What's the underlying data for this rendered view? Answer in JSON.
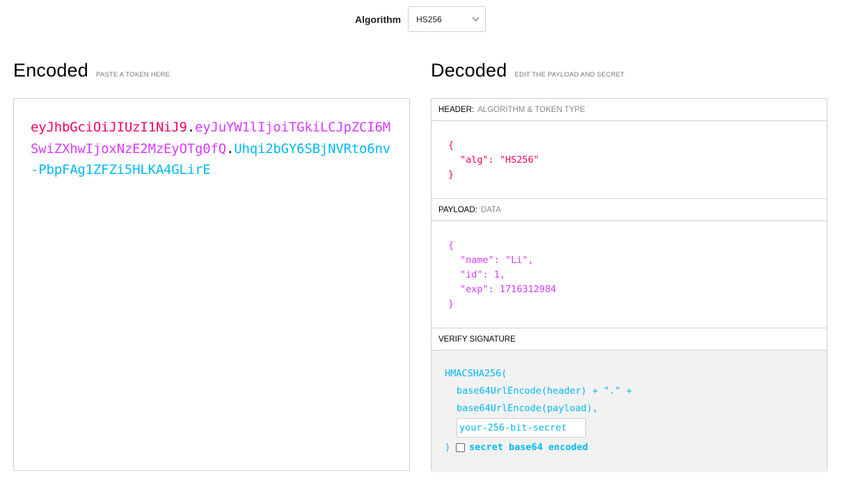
{
  "algorithm": {
    "label": "Algorithm",
    "selected": "HS256"
  },
  "encoded": {
    "title": "Encoded",
    "subtitle": "PASTE A TOKEN HERE",
    "token_header": "eyJhbGciOiJIUzI1NiJ9",
    "token_payload": "eyJuYW1lIjoiTGkiLCJpZCI6MSwiZXhwIjoxNzE2MzEyOTg0fQ",
    "token_signature": "Uhqi2bGY6SBjNVRto6nv-PbpFAg1ZFZi5HLKA4GLirE",
    "dot": "."
  },
  "decoded": {
    "title": "Decoded",
    "subtitle": "EDIT THE PAYLOAD AND SECRET",
    "header": {
      "label": "HEADER:",
      "sublabel": "ALGORITHM & TOKEN TYPE",
      "open": "{",
      "lines": [
        "\"alg\": \"HS256\""
      ],
      "close": "}"
    },
    "payload": {
      "label": "PAYLOAD:",
      "sublabel": "DATA",
      "open": "{",
      "lines": [
        "\"name\": \"Li\",",
        "\"id\": 1,",
        "\"exp\": 1716312984"
      ],
      "close": "}"
    },
    "signature": {
      "label": "VERIFY SIGNATURE",
      "line1": "HMACSHA256(",
      "line2": "base64UrlEncode(header) + \".\" +",
      "line3": "base64UrlEncode(payload),",
      "secret_value": "your-256-bit-secret",
      "close": ")",
      "checkbox_label": "secret base64 encoded"
    }
  }
}
